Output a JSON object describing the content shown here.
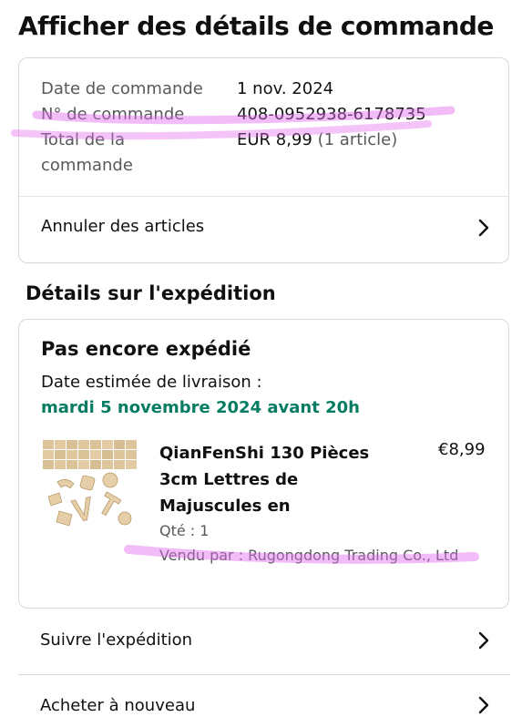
{
  "page": {
    "title": "Afficher des détails de commande"
  },
  "order": {
    "date_label": "Date de commande",
    "date_value": "1 nov. 2024",
    "number_label": "N° de commande",
    "number_value": "408-0952938-6178735",
    "total_label_1": "Total de la",
    "total_label_2": "commande",
    "total_value": "EUR 8,99",
    "total_count": "(1 article)",
    "cancel_label": "Annuler des articles"
  },
  "shipment": {
    "section_title": "Détails sur l'expédition",
    "status": "Pas encore expédié",
    "est_label": "Date estimée de livraison :",
    "est_date": "mardi 5 novembre 2024 avant 20h",
    "product": {
      "title": "QianFenShi 130 Pièces 3cm Lettres de Majuscules en",
      "price": "€8,99",
      "qty": "Qté : 1",
      "seller": "Vendu par : Rugongdong Trading Co., Ltd"
    },
    "track_label": "Suivre l'expédition",
    "buy_again_label": "Acheter à nouveau"
  },
  "colors": {
    "delivery_green": "#067d62",
    "highlight": "#e36bf0"
  },
  "icons": {
    "chevron": "chevron-right-icon"
  }
}
